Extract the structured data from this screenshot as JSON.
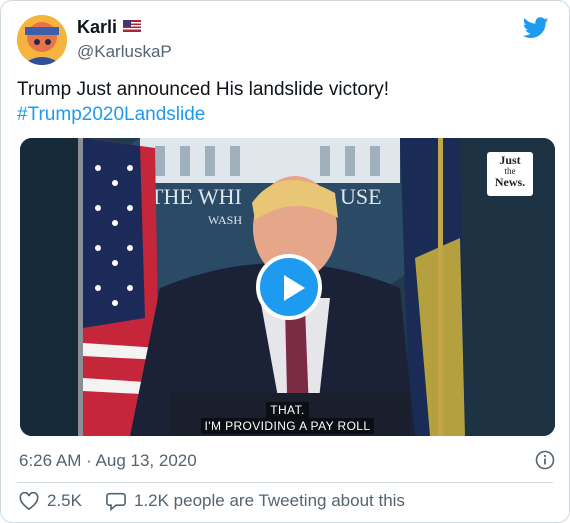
{
  "author": {
    "display_name": "Karli",
    "flag_icon": "us-flag-icon",
    "handle": "@KarluskaP"
  },
  "tweet": {
    "text": "Trump Just announced His landslide victory!",
    "hashtag": "#Trump2020Landslide"
  },
  "media": {
    "badge": {
      "line1": "Just",
      "line2": "the",
      "line3": "News."
    },
    "captions": [
      "THAT.",
      "I'M PROVIDING A PAY ROLL"
    ],
    "sign_text_1": "THE WHI",
    "sign_text_2": "USE",
    "sign_text_3": "WASH"
  },
  "meta": {
    "timestamp": "6:26 AM · Aug 13, 2020"
  },
  "engagement": {
    "likes": "2.5K",
    "conversation": "1.2K people are Tweeting about this"
  },
  "colors": {
    "accent": "#1d9bf0",
    "secondary_text": "#536471",
    "primary_text": "#0f1419",
    "border": "#cfd9de"
  }
}
